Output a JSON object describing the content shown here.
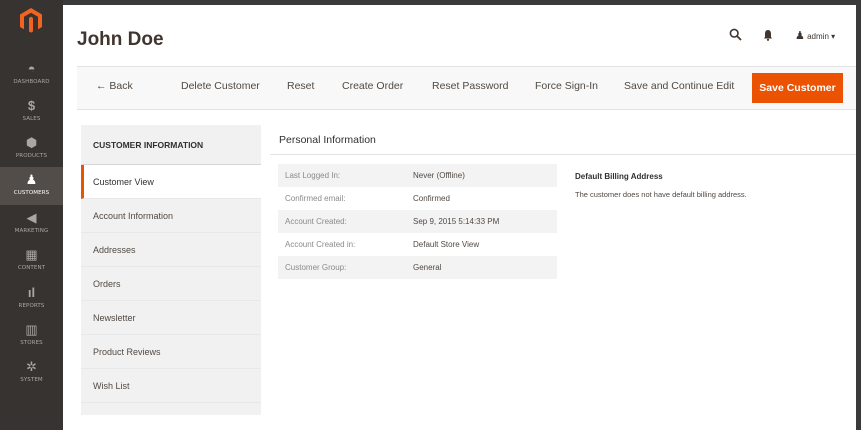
{
  "sidebar": {
    "items": [
      {
        "label": "DASHBOARD",
        "icon": "speedometer-icon"
      },
      {
        "label": "SALES",
        "icon": "dollar-icon"
      },
      {
        "label": "PRODUCTS",
        "icon": "cube-icon"
      },
      {
        "label": "CUSTOMERS",
        "icon": "person-icon"
      },
      {
        "label": "MARKETING",
        "icon": "megaphone-icon"
      },
      {
        "label": "CONTENT",
        "icon": "layout-icon"
      },
      {
        "label": "REPORTS",
        "icon": "bar-chart-icon"
      },
      {
        "label": "STORES",
        "icon": "store-icon"
      },
      {
        "label": "SYSTEM",
        "icon": "gear-icon"
      }
    ],
    "active": "CUSTOMERS"
  },
  "header": {
    "title": "John Doe",
    "user": "admin"
  },
  "actions": {
    "back": "Back",
    "delete": "Delete Customer",
    "reset": "Reset",
    "create_order": "Create Order",
    "reset_password": "Reset Password",
    "force_signin": "Force Sign-In",
    "save_continue": "Save and Continue Edit",
    "save": "Save Customer"
  },
  "tabs": {
    "header": "CUSTOMER INFORMATION",
    "items": [
      "Customer View",
      "Account Information",
      "Addresses",
      "Orders",
      "Newsletter",
      "Product Reviews",
      "Wish List"
    ]
  },
  "personal": {
    "title": "Personal Information",
    "rows": [
      {
        "label": "Last Logged In:",
        "value": "Never (Offline)"
      },
      {
        "label": "Confirmed email:",
        "value": "Confirmed"
      },
      {
        "label": "Account Created:",
        "value": "Sep 9, 2015 5:14:33 PM"
      },
      {
        "label": "Account Created in:",
        "value": "Default Store View"
      },
      {
        "label": "Customer Group:",
        "value": "General"
      }
    ]
  },
  "billing": {
    "title": "Default Billing Address",
    "text": "The customer does not have default billing address."
  },
  "colors": {
    "accent": "#eb5202",
    "sidebar": "#373330"
  }
}
